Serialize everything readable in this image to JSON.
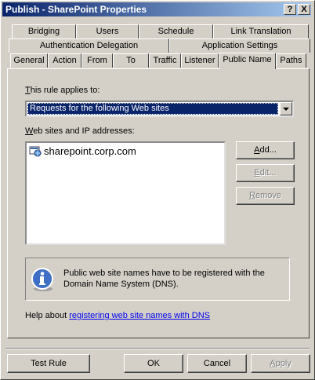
{
  "window": {
    "title": "Publish - SharePoint Properties",
    "help_btn": "?",
    "close_btn": "X"
  },
  "tabs": {
    "row1": [
      "Bridging",
      "Users",
      "Schedule",
      "Link Translation"
    ],
    "row2": [
      "Authentication Delegation",
      "Application Settings"
    ],
    "row3": [
      "General",
      "Action",
      "From",
      "To",
      "Traffic",
      "Listener",
      "Public Name",
      "Paths"
    ],
    "active": "Public Name"
  },
  "applies": {
    "label_hot": "T",
    "label_rest": "his rule applies to:",
    "selected": "Requests for the following Web sites"
  },
  "sites": {
    "label_hot": "W",
    "label_rest": "eb sites and IP addresses:",
    "items": [
      "sharepoint.corp.com"
    ]
  },
  "buttons": {
    "add_hot": "A",
    "add_rest": "dd...",
    "edit_hot": "E",
    "edit_rest": "dit...",
    "remove_hot": "R",
    "remove_rest": "emove"
  },
  "info": {
    "text": "Public web site names have to be registered with the Domain Name System (DNS)."
  },
  "help": {
    "prefix": "Help about ",
    "link": "registering web site names with DNS"
  },
  "footer": {
    "test_rule": "Test Rule",
    "ok": "OK",
    "cancel": "Cancel",
    "apply_hot": "A",
    "apply_rest": "pply"
  },
  "icons": [
    "help-button-icon",
    "close-icon",
    "dropdown-arrow-icon",
    "website-globe-icon",
    "info-icon"
  ]
}
